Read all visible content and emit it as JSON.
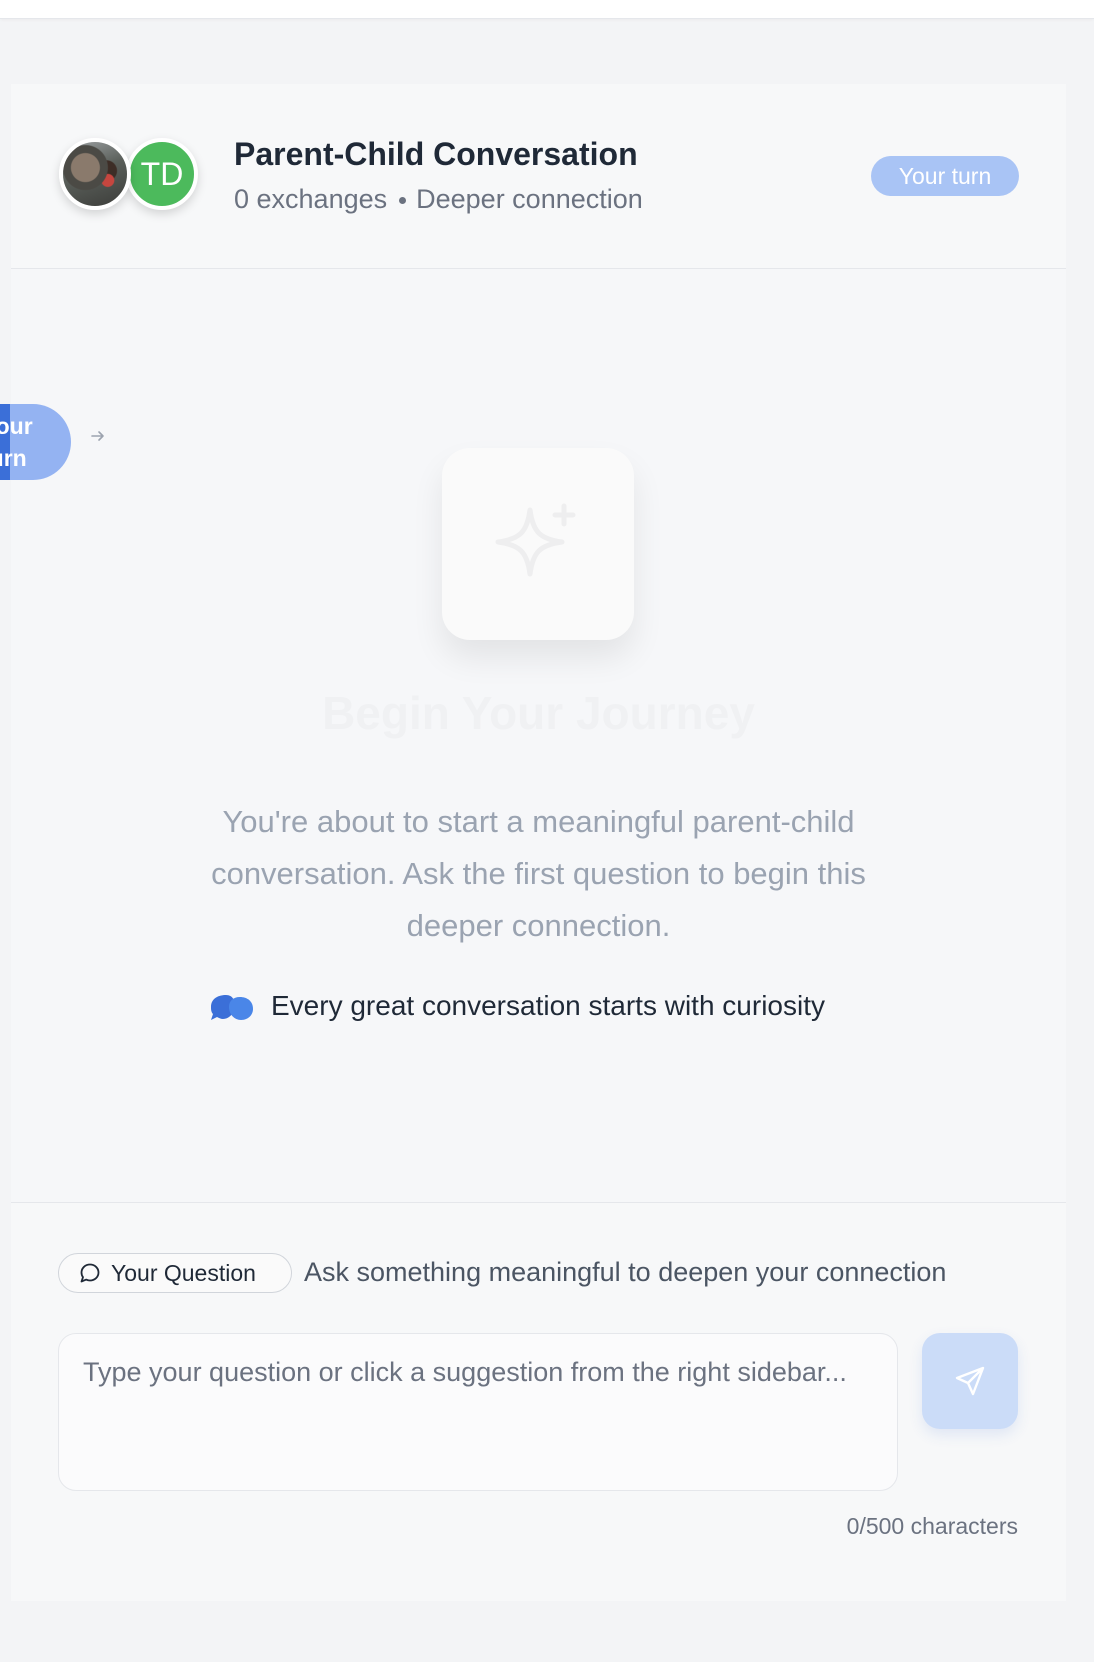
{
  "header": {
    "title": "Parent-Child Conversation",
    "exchanges": "0 exchanges",
    "subtitle": "Deeper connection",
    "turn_badge": "Your turn",
    "avatar_initials": "TD"
  },
  "side_indicator": {
    "label": "Your\nturn"
  },
  "empty_state": {
    "title": "Begin Your Journey",
    "description": "You're about to start a meaningful parent-child conversation. Ask the first question to begin this deeper connection.",
    "tip": "Every great conversation starts with curiosity"
  },
  "composer": {
    "pill_label": "Your Question",
    "helper": "Ask something meaningful to deepen your connection",
    "placeholder": "Type your question or click a suggestion from the right sidebar...",
    "value": "",
    "char_count": "0/500 characters"
  },
  "colors": {
    "accent": "#3b6fd8",
    "badge": "#a9c4f5",
    "avatar_green": "#4cba5c"
  },
  "icons": [
    "sparkles-icon",
    "quote-icon",
    "message-circle-icon",
    "send-icon",
    "arrow-right-icon"
  ]
}
